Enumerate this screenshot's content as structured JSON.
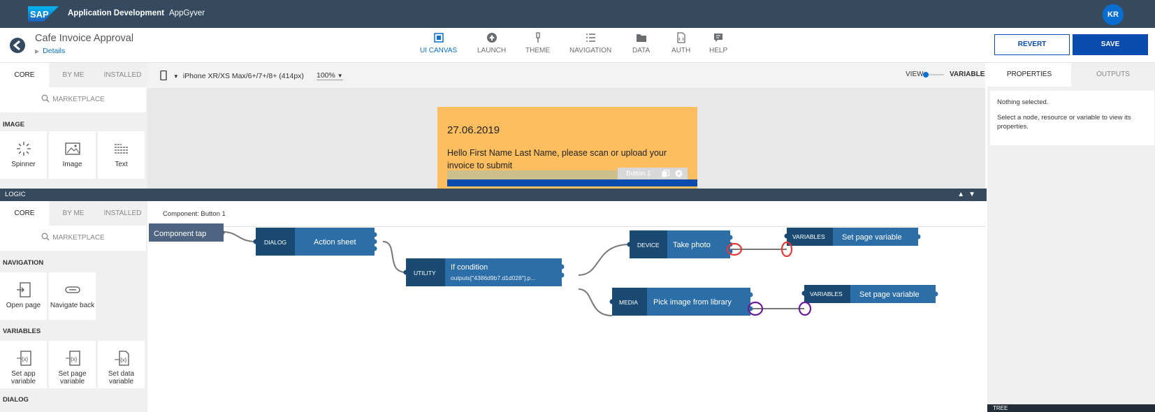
{
  "shell": {
    "brand": "SAP",
    "title": "Application Development",
    "subtitle": "AppGyver",
    "avatar": "KR"
  },
  "app": {
    "title": "Cafe Invoice Approval",
    "breadcrumb": "Details"
  },
  "nav": [
    {
      "label": "UI CANVAS",
      "icon": "ui-canvas-icon",
      "active": true
    },
    {
      "label": "LAUNCH",
      "icon": "launch-icon"
    },
    {
      "label": "THEME",
      "icon": "theme-icon"
    },
    {
      "label": "NAVIGATION",
      "icon": "navigation-icon"
    },
    {
      "label": "DATA",
      "icon": "data-icon"
    },
    {
      "label": "AUTH",
      "icon": "auth-icon"
    },
    {
      "label": "HELP",
      "icon": "help-icon"
    }
  ],
  "actions": {
    "revert": "REVERT",
    "save": "SAVE"
  },
  "tabs": {
    "core": "CORE",
    "by_me": "BY ME",
    "installed": "INSTALLED",
    "marketplace": "MARKETPLACE"
  },
  "components": {
    "section": "IMAGE",
    "items": [
      {
        "label": "Spinner",
        "icon": "spinner-icon"
      },
      {
        "label": "Image",
        "icon": "image-icon"
      },
      {
        "label": "Text",
        "icon": "text-icon"
      }
    ]
  },
  "canvas": {
    "device": "iPhone XR/XS Max/6+/7+/8+ (414px)",
    "zoom": "100%",
    "view": "VIEW",
    "variables": "VARIABLES",
    "date": "27.06.2019",
    "greeting": "Hello First Name Last Name, please scan or upload your invoice to submit",
    "button_chip": "Button 1"
  },
  "properties": {
    "tab_properties": "PROPERTIES",
    "tab_outputs": "OUTPUTS",
    "empty_title": "Nothing selected.",
    "empty_text": "Select a node, resource or variable to view its properties."
  },
  "logic": {
    "bar_label": "LOGIC",
    "component": "Component: Button 1",
    "sections": {
      "navigation": "NAVIGATION",
      "variables": "VARIABLES",
      "dialog": "DIALOG"
    },
    "nav_items": [
      {
        "label": "Open page",
        "icon": "open-page-icon"
      },
      {
        "label": "Navigate back",
        "icon": "navigate-back-icon"
      }
    ],
    "var_items": [
      {
        "label": "Set app variable",
        "icon": "set-app-variable-icon"
      },
      {
        "label": "Set page variable",
        "icon": "set-page-variable-icon"
      },
      {
        "label": "Set data variable",
        "icon": "set-data-variable-icon"
      }
    ],
    "nodes": {
      "trigger": "Component tap",
      "dialog": {
        "cat": "DIALOG",
        "name": "Action sheet"
      },
      "utility": {
        "cat": "UTILITY",
        "name": "If condition",
        "sub": "outputs[\"4386d9b7.d1d028\"].p..."
      },
      "device": {
        "cat": "DEVICE",
        "name": "Take photo"
      },
      "media": {
        "cat": "MEDIA",
        "name": "Pick image from library"
      },
      "var1": {
        "cat": "VARIABLES",
        "name": "Set page variable"
      },
      "var2": {
        "cat": "VARIABLES",
        "name": "Set page variable"
      }
    }
  },
  "tree": "TREE",
  "colors": {
    "shell": "#354a5f",
    "accent": "#0a6ed1",
    "node_dark": "#1a4a72",
    "node_light": "#2c6ea8",
    "highlight_red": "#e53935",
    "highlight_purple": "#6a1b9a",
    "phone_bg": "#fcbe5f"
  }
}
